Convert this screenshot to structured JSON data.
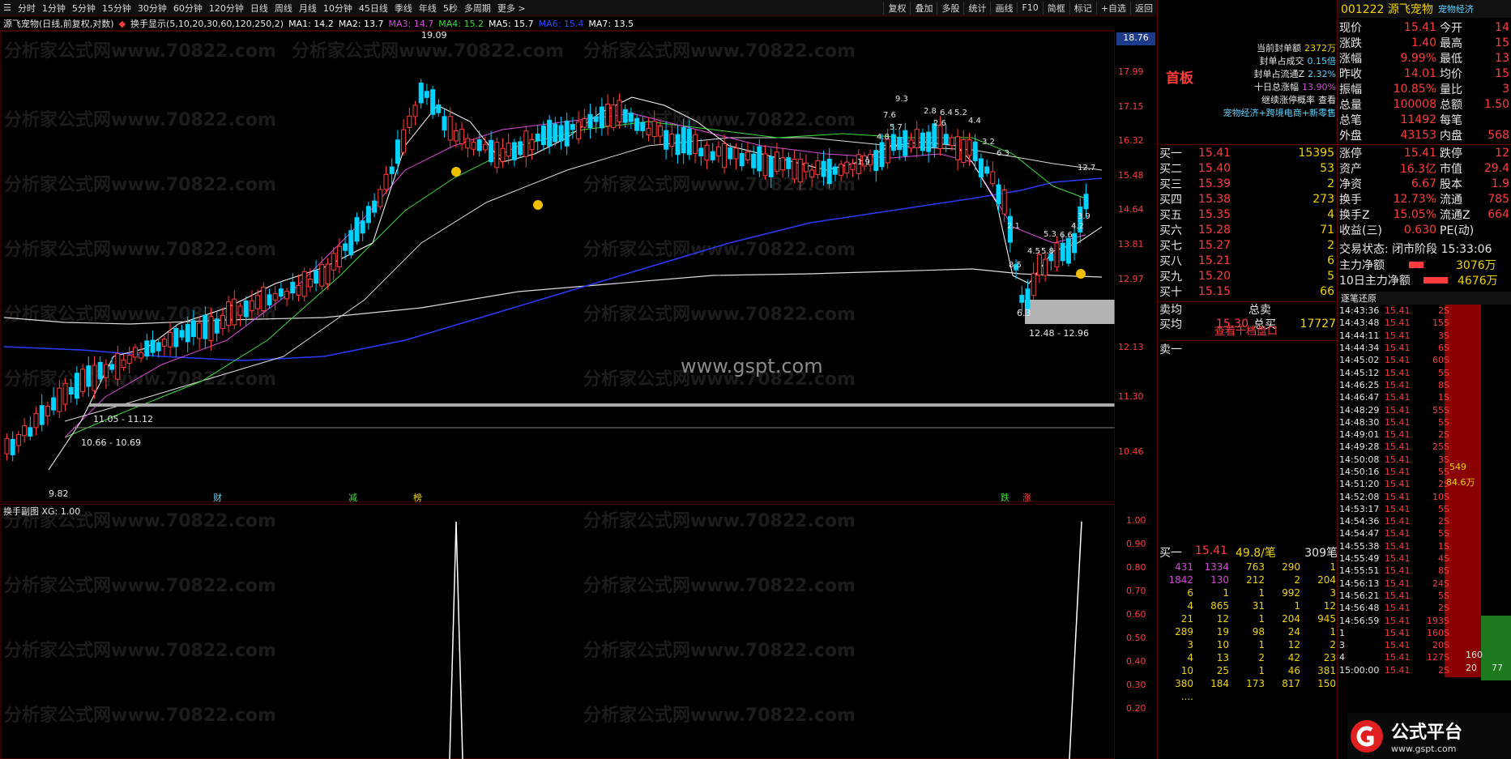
{
  "toolbar": {
    "periods": [
      "分时",
      "1分钟",
      "5分钟",
      "15分钟",
      "30分钟",
      "60分钟",
      "120分钟",
      "日线",
      "周线",
      "月线",
      "10分钟",
      "45日线",
      "季线",
      "年线",
      "5秒",
      "多周期",
      "更多 >"
    ],
    "right_buttons": [
      "复权",
      "叠加",
      "多股",
      "统计",
      "画线",
      "F10",
      "简框",
      "标记",
      "+自选",
      "返回"
    ]
  },
  "chart_header": {
    "title": "源飞宠物(日线,前复权,对数)",
    "indicator": "换手显示(5,10,20,30,60,120,250,2)",
    "ma": [
      {
        "label": "MA1: 14.2",
        "color": "#ffffff"
      },
      {
        "label": "MA2: 13.7",
        "color": "#ffffff"
      },
      {
        "label": "MA3: 14.7",
        "color": "#e04ae0"
      },
      {
        "label": "MA4: 15.2",
        "color": "#3cdc3c"
      },
      {
        "label": "MA5: 15.7",
        "color": "#ffffff"
      },
      {
        "label": "MA6: 15.4",
        "color": "#2a4aff"
      },
      {
        "label": "MA7: 13.5",
        "color": "#ffffff"
      }
    ]
  },
  "price_axis": [
    "18.76",
    "17.99",
    "17.15",
    "16.32",
    "15.48",
    "14.64",
    "13.81",
    "12.97",
    "12.13",
    "11.30",
    "10.46"
  ],
  "price_axis_current": "18.76",
  "annotations": {
    "high_label": "19.09",
    "low_label": "9.82",
    "range1": "11.05 - 11.12",
    "range2": "10.66 - 10.69",
    "range3": "12.48 - 12.96",
    "gap_value": "6.3",
    "watermark": "www.gspt.com",
    "bg_watermark": "分析家公式网www.70822.com",
    "event_tags": [
      "财",
      "减",
      "榜",
      "跌",
      "涨"
    ],
    "turnover_peaks": [
      "9.3",
      "7.6",
      "5.7",
      "4.8",
      "2.8",
      "6.4",
      "5.2",
      "4.4",
      "2.6",
      "3.2",
      "6.3",
      "2.1",
      "8.5",
      "4.5",
      "5.8",
      "5.3",
      "6.6",
      "4.2",
      "3.9",
      "12.7",
      "1.9"
    ]
  },
  "sub_chart": {
    "title": "换手副图 XG: 1.00",
    "axis": [
      "1.00",
      "0.90",
      "0.80",
      "0.70",
      "0.60",
      "0.50",
      "0.40",
      "0.30",
      "0.20"
    ]
  },
  "quote": {
    "code_name": "001222 源飞宠物",
    "tag": "宠物经济",
    "board": "首板",
    "limit_info": [
      {
        "label": "当前封单额",
        "value": "2372万"
      },
      {
        "label": "封单占成交",
        "value": "0.15倍"
      },
      {
        "label": "封单占流通Z",
        "value": "2.32%"
      },
      {
        "label": "十日总涨幅",
        "value": "13.90%"
      },
      {
        "label": "继续涨停概率",
        "value": "查看"
      }
    ],
    "concepts": "宠物经济+跨境电商+新零售",
    "stats": [
      {
        "k1": "现价",
        "v1": "15.41",
        "k2": "今开",
        "v2": "14"
      },
      {
        "k1": "涨跌",
        "v1": "1.40",
        "k2": "最高",
        "v2": "15"
      },
      {
        "k1": "涨幅",
        "v1": "9.99%",
        "k2": "最低",
        "v2": "13"
      },
      {
        "k1": "昨收",
        "v1": "14.01",
        "k2": "均价",
        "v2": "15"
      },
      {
        "k1": "振幅",
        "v1": "10.85%",
        "k2": "量比",
        "v2": "3"
      },
      {
        "k1": "总量",
        "v1": "100008",
        "k2": "总额",
        "v2": "1.50"
      },
      {
        "k1": "总笔",
        "v1": "11492",
        "k2": "每笔",
        "v2": ""
      },
      {
        "k1": "外盘",
        "v1": "43153",
        "k2": "内盘",
        "v2": "568"
      }
    ],
    "stats2": [
      {
        "k1": "涨停",
        "v1": "15.41",
        "k2": "跌停",
        "v2": "12"
      },
      {
        "k1": "资产",
        "v1": "16.3亿",
        "k2": "市值",
        "v2": "29.4"
      },
      {
        "k1": "净资",
        "v1": "6.67",
        "k2": "股本",
        "v2": "1.9"
      },
      {
        "k1": "换手",
        "v1": "12.73%",
        "k2": "流通",
        "v2": "785"
      },
      {
        "k1": "换手Z",
        "v1": "15.05%",
        "k2": "流通Z",
        "v2": "664"
      },
      {
        "k1": "收益(三)",
        "v1": "0.630",
        "k2": "PE(动)",
        "v2": ""
      }
    ],
    "trade_status": "交易状态: 闭市阶段 15:33:06",
    "main_net": {
      "label": "主力净额",
      "value": "3076万"
    },
    "main_net10": {
      "label": "10日主力净额",
      "value": "4676万"
    },
    "bids": [
      {
        "label": "买一",
        "price": "15.41",
        "vol": "15395"
      },
      {
        "label": "买二",
        "price": "15.40",
        "vol": "53"
      },
      {
        "label": "买三",
        "price": "15.39",
        "vol": "2"
      },
      {
        "label": "买四",
        "price": "15.38",
        "vol": "273"
      },
      {
        "label": "买五",
        "price": "15.35",
        "vol": "4"
      },
      {
        "label": "买六",
        "price": "15.28",
        "vol": "71"
      },
      {
        "label": "买七",
        "price": "15.27",
        "vol": "2"
      },
      {
        "label": "买八",
        "price": "15.21",
        "vol": "6"
      },
      {
        "label": "买九",
        "price": "15.20",
        "vol": "5"
      },
      {
        "label": "买十",
        "price": "15.15",
        "vol": "66"
      }
    ],
    "avg": [
      {
        "k": "卖均",
        "v": "",
        "k2": "总卖",
        "v2": ""
      },
      {
        "k": "买均",
        "v": "15.30",
        "k2": "总买",
        "v2": "17727"
      }
    ],
    "view_levels": "查看千档盘口",
    "sell1": "卖一",
    "queue_header": {
      "label": "买一",
      "price": "15.41",
      "per": "49.8/笔",
      "count": "309笔"
    },
    "queue": [
      [
        "431",
        "1334",
        "763",
        "290",
        "1"
      ],
      [
        "1842",
        "130",
        "212",
        "2",
        "204"
      ],
      [
        "6",
        "1",
        "1",
        "992",
        "3"
      ],
      [
        "4",
        "865",
        "31",
        "1",
        "12"
      ],
      [
        "21",
        "12",
        "1",
        "204",
        "945"
      ],
      [
        "289",
        "19",
        "98",
        "24",
        "1"
      ],
      [
        "3",
        "10",
        "1",
        "12",
        "2"
      ],
      [
        "4",
        "13",
        "2",
        "42",
        "23"
      ],
      [
        "10",
        "25",
        "1",
        "46",
        "381"
      ],
      [
        "380",
        "184",
        "173",
        "817",
        "150"
      ],
      [
        "....",
        "",
        "",
        "",
        ""
      ]
    ],
    "ticks_title": "逐笔还原",
    "ticks": [
      [
        "14:43:36",
        "15.41",
        "2S"
      ],
      [
        "14:43:48",
        "15.41",
        "15S"
      ],
      [
        "14:44:11",
        "15.41",
        "3S"
      ],
      [
        "14:44:34",
        "15.41",
        "6S"
      ],
      [
        "14:45:02",
        "15.41",
        "60S"
      ],
      [
        "14:45:12",
        "15.41",
        "5S"
      ],
      [
        "14:46:25",
        "15.41",
        "8S"
      ],
      [
        "14:46:47",
        "15.41",
        "1S"
      ],
      [
        "14:48:29",
        "15.41",
        "55S"
      ],
      [
        "14:48:30",
        "15.41",
        "5S"
      ],
      [
        "14:49:01",
        "15.41",
        "2S"
      ],
      [
        "14:49:28",
        "15.41",
        "25S"
      ],
      [
        "14:50:08",
        "15.41",
        "3S"
      ],
      [
        "14:50:16",
        "15.41",
        "5S"
      ],
      [
        "14:51:20",
        "15.41",
        "2S"
      ],
      [
        "14:52:08",
        "15.41",
        "10S"
      ],
      [
        "14:53:17",
        "15.41",
        "5S"
      ],
      [
        "14:54:36",
        "15.41",
        "2S"
      ],
      [
        "14:54:47",
        "15.41",
        "5S"
      ],
      [
        "14:55:38",
        "15.41",
        "1S"
      ],
      [
        "14:55:49",
        "15.41",
        "4S"
      ],
      [
        "14:55:51",
        "15.41",
        "8S"
      ],
      [
        "14:56:13",
        "15.41",
        "24S"
      ],
      [
        "14:56:21",
        "15.41",
        "5S"
      ],
      [
        "14:56:48",
        "15.41",
        "2S"
      ],
      [
        "14:56:59",
        "15.41",
        "193S"
      ],
      [
        "1",
        "15.41",
        "160S"
      ],
      [
        "3",
        "15.41",
        "20S"
      ],
      [
        "4",
        "15.41",
        "127S"
      ],
      [
        "15:00:00",
        "15.41",
        "2S"
      ]
    ],
    "tick_side_vals": [
      "549",
      "84.6万",
      "160",
      "20",
      "77"
    ],
    "logo_text": "公式平台",
    "logo_url": "www.gspt.com"
  }
}
